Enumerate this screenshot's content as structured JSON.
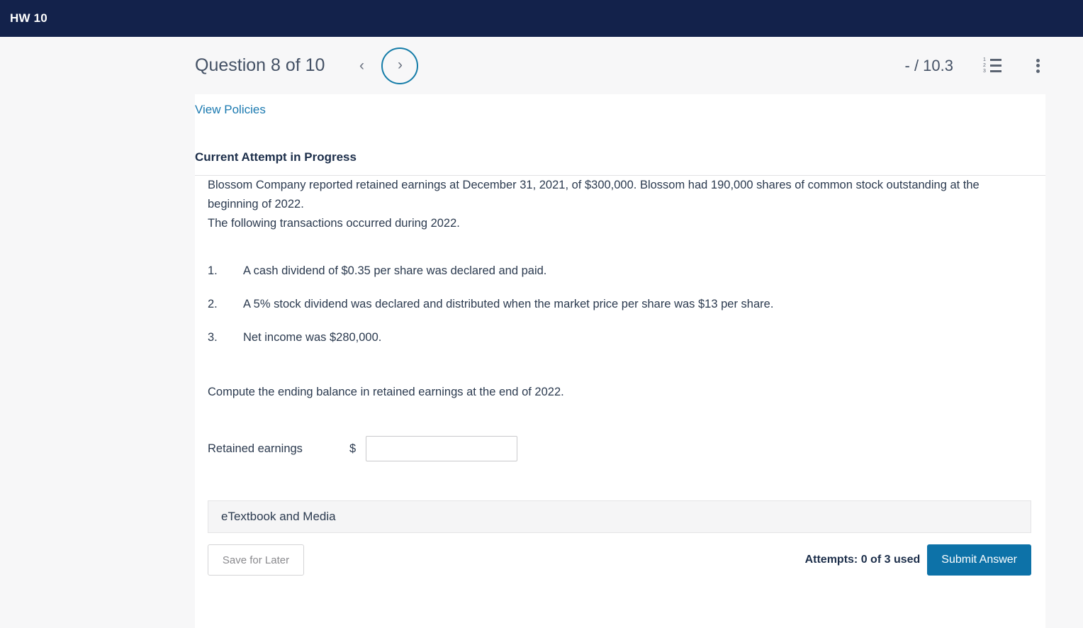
{
  "topbar": {
    "title": "HW 10"
  },
  "question_header": {
    "title": "Question 8 of 10",
    "prev_glyph": "‹",
    "next_glyph": "›",
    "score": "- / 10.3",
    "list_icon_numbers": [
      "1",
      "2",
      "3"
    ]
  },
  "card": {
    "view_policies": "View Policies",
    "attempt_heading": "Current Attempt in Progress",
    "paragraph_1": "Blossom Company reported retained earnings at December 31, 2021, of $300,000. Blossom had 190,000 shares of common stock outstanding at the beginning of 2022.",
    "paragraph_2": "The following transactions occurred during 2022.",
    "transactions": [
      {
        "index": "1.",
        "text": "A cash dividend of $0.35 per share was declared and paid."
      },
      {
        "index": "2.",
        "text": "A 5% stock dividend was declared and distributed when the market price per share was $13 per share."
      },
      {
        "index": "3.",
        "text": "Net income was $280,000."
      }
    ],
    "compute_instruction": "Compute the ending balance in retained earnings at the end of 2022.",
    "answer": {
      "label": "Retained earnings",
      "currency_symbol": "$",
      "value": "",
      "placeholder": ""
    },
    "etextbook_label": "eTextbook and Media",
    "footer": {
      "save_label": "Save for Later",
      "attempts_text": "Attempts: 0 of 3 used",
      "submit_label": "Submit Answer"
    }
  },
  "colors": {
    "topbar_bg": "#13224b",
    "page_bg": "#f7f7f8",
    "link_blue": "#1a79b0",
    "accent_blue": "#0d72a8",
    "next_circle_border": "#147ca8",
    "text_dark": "#1c2e4a"
  }
}
